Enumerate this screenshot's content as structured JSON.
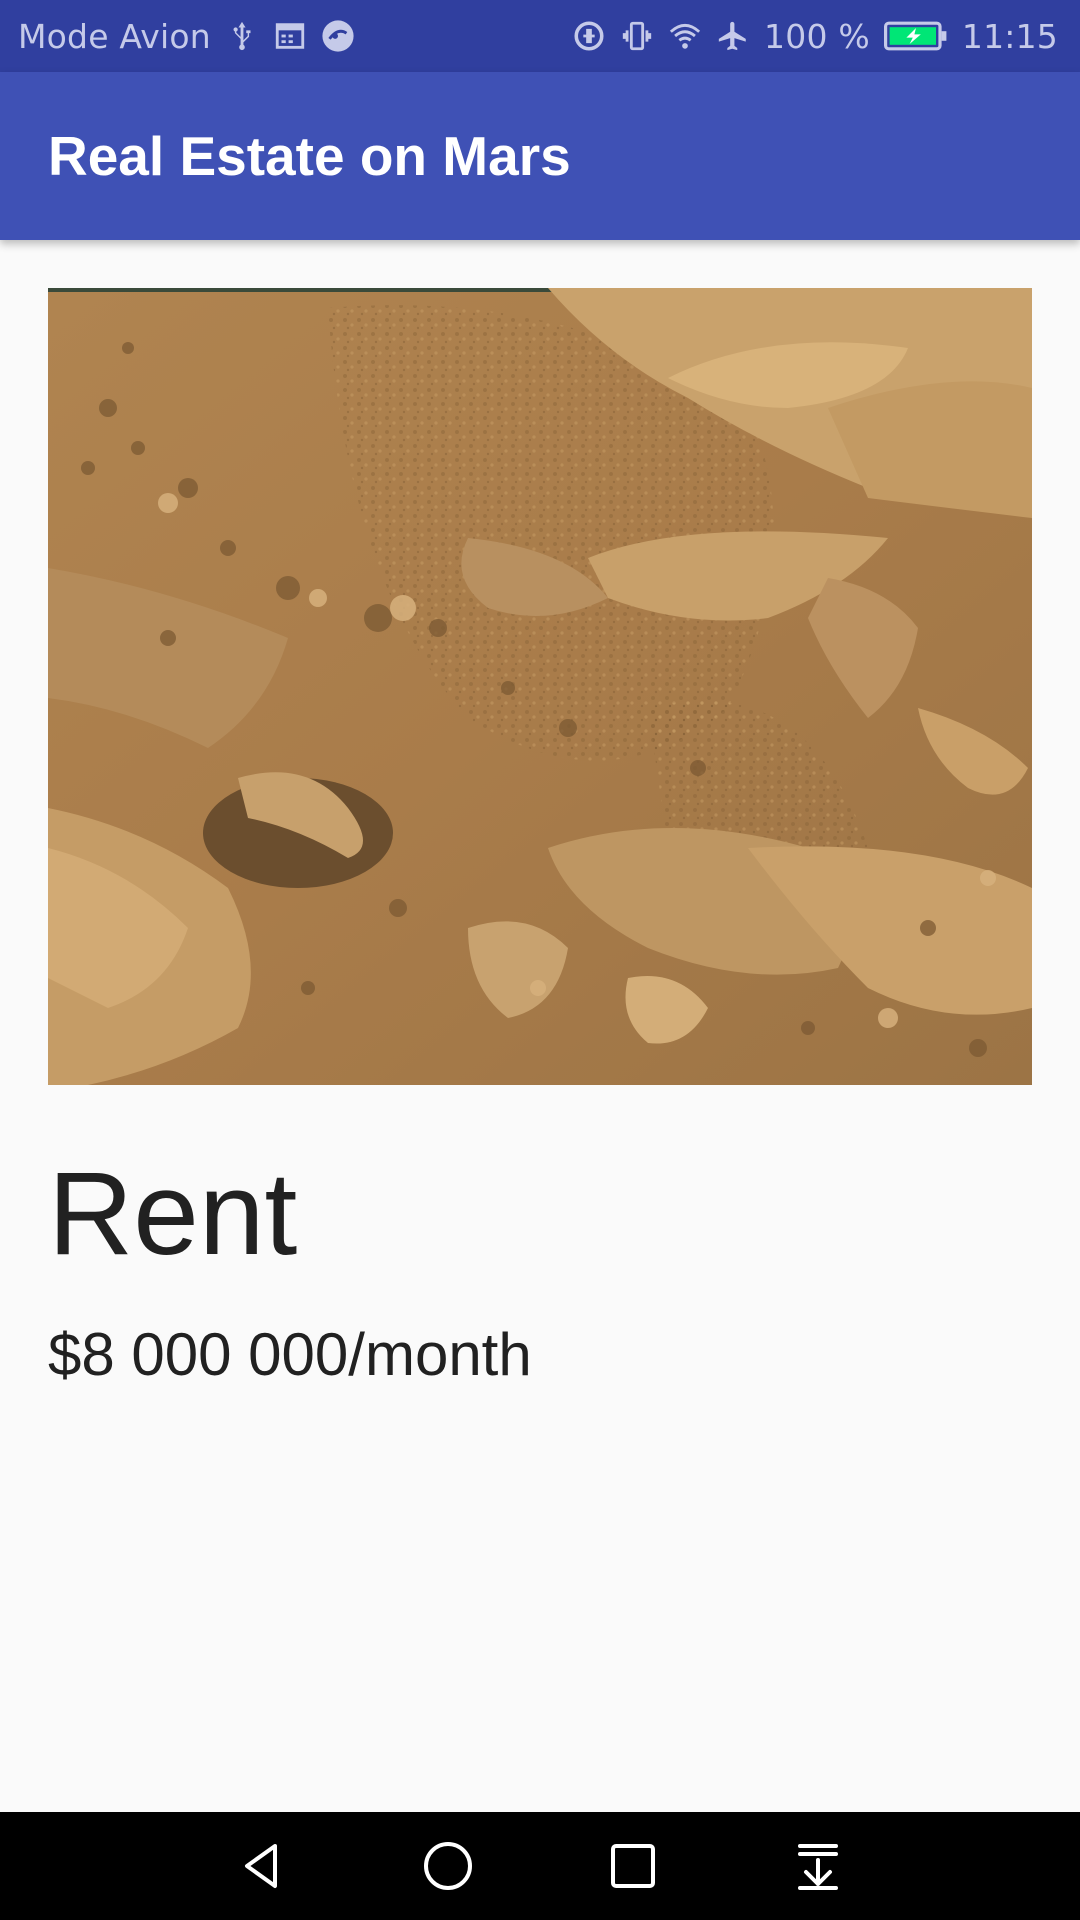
{
  "status_bar": {
    "carrier_text": "Mode Avion",
    "battery_percent": "100 %",
    "time": "11:15",
    "icons_left": [
      "usb-icon",
      "calendar-icon",
      "app-notification-icon"
    ],
    "icons_right": [
      "data-saver-icon",
      "vibrate-icon",
      "wifi-icon",
      "airplane-mode-icon",
      "battery-charging-icon"
    ],
    "colors": {
      "background": "#303f9f",
      "foreground": "#c5cae9",
      "battery_fill": "#00e676"
    }
  },
  "app_bar": {
    "title": "Real Estate on Mars",
    "colors": {
      "background": "#3f51b5",
      "title": "#ffffff"
    }
  },
  "detail": {
    "image_description_icon": "mars-surface-photo",
    "type": "Rent",
    "price": "$8 000 000/month"
  },
  "nav_bar": {
    "buttons": [
      "back-icon",
      "home-icon",
      "recents-icon",
      "notification-shade-icon"
    ]
  }
}
